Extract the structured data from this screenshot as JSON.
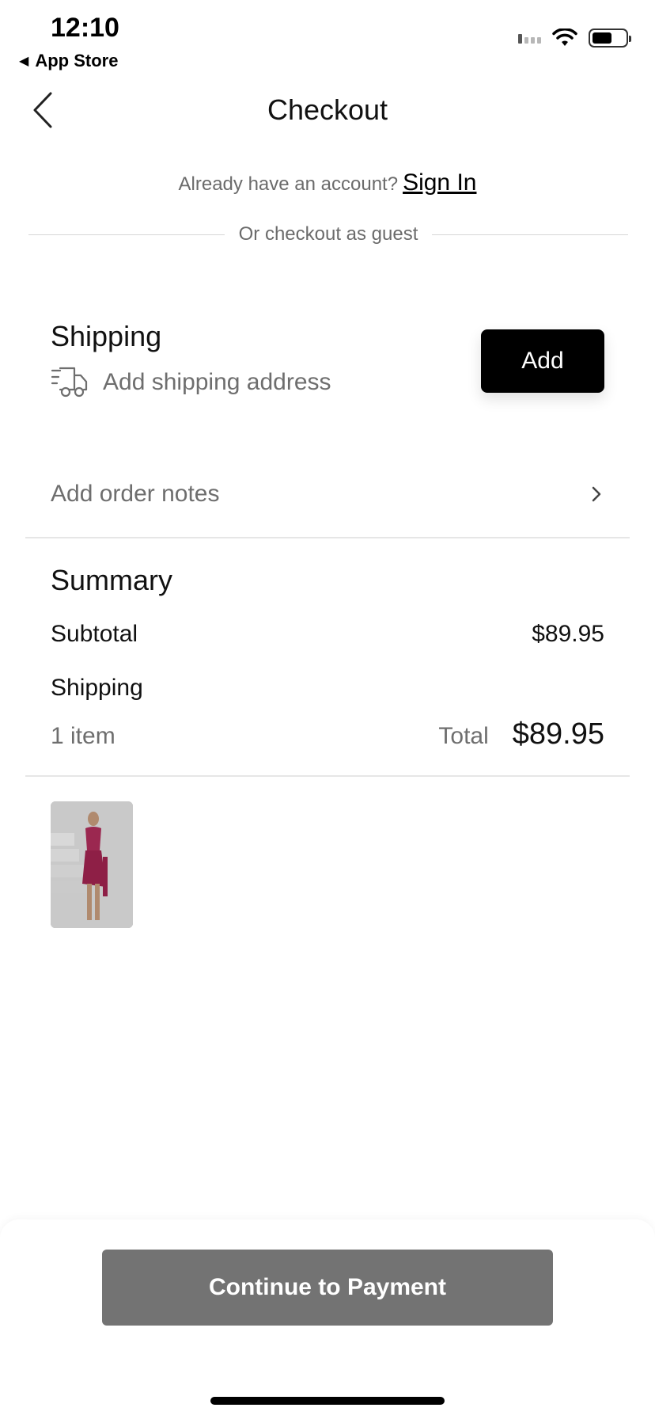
{
  "status_bar": {
    "time": "12:10",
    "back_app": "App Store"
  },
  "nav": {
    "title": "Checkout",
    "back_icon": "chevron-left-icon"
  },
  "account": {
    "prompt": "Already have an account?",
    "sign_in": "Sign In",
    "guest": "Or checkout as guest"
  },
  "shipping": {
    "title": "Shipping",
    "subtitle": "Add shipping address",
    "icon": "delivery-truck-icon",
    "add_label": "Add"
  },
  "order_notes": {
    "label": "Add order notes",
    "icon": "chevron-right-icon"
  },
  "summary": {
    "title": "Summary",
    "subtotal_label": "Subtotal",
    "subtotal_value": "$89.95",
    "shipping_label": "Shipping",
    "item_count": "1 item",
    "total_label": "Total",
    "total_value": "$89.95"
  },
  "footer": {
    "continue_label": "Continue to Payment"
  },
  "colors": {
    "primary_button": "#000000",
    "disabled_button": "#737373",
    "muted_text": "#6e6e6e"
  }
}
